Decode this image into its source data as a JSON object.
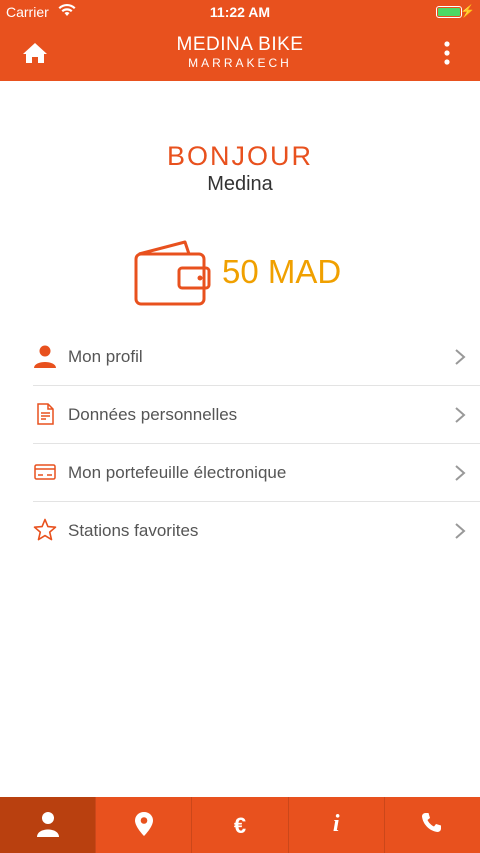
{
  "status_bar": {
    "carrier": "Carrier",
    "time": "11:22 AM",
    "battery_level": 1.0
  },
  "header": {
    "title": "MEDINA BIKE",
    "subtitle": "MARRAKECH",
    "home_icon": "home-icon",
    "menu_icon": "more-vertical-icon"
  },
  "greeting": {
    "hello": "BONJOUR",
    "name": "Medina"
  },
  "wallet": {
    "icon": "wallet-icon",
    "balance": "50 MAD"
  },
  "menu": {
    "items": [
      {
        "label": "Mon profil",
        "icon": "user-icon"
      },
      {
        "label": "Données personnelles",
        "icon": "document-icon"
      },
      {
        "label": "Mon portefeuille électronique",
        "icon": "credit-card-icon"
      },
      {
        "label": "Stations favorites",
        "icon": "star-icon"
      }
    ]
  },
  "tabs": [
    {
      "icon": "user-icon",
      "active": true
    },
    {
      "icon": "map-pin-icon",
      "active": false
    },
    {
      "icon": "euro-icon",
      "glyph": "€",
      "active": false
    },
    {
      "icon": "info-icon",
      "glyph": "i",
      "active": false
    },
    {
      "icon": "phone-icon",
      "active": false
    }
  ],
  "colors": {
    "primary": "#e8511e",
    "primary_dark": "#b9400f",
    "balance": "#f0a000"
  }
}
